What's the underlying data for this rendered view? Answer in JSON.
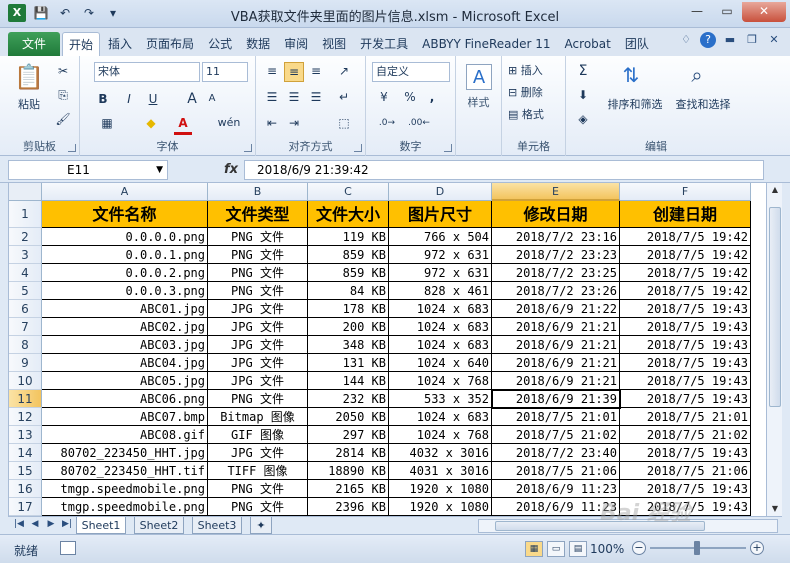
{
  "titlebar": {
    "title": "VBA获取文件夹里面的图片信息.xlsm - Microsoft Excel",
    "app_icon": "X"
  },
  "qat": {
    "icons": [
      "save-icon",
      "undo-icon",
      "redo-icon",
      "customize-icon"
    ]
  },
  "tabs": [
    "文件",
    "开始",
    "插入",
    "页面布局",
    "公式",
    "数据",
    "审阅",
    "视图",
    "开发工具",
    "ABBYY FineReader 11",
    "Acrobat",
    "团队"
  ],
  "ribbon": {
    "clipboard": {
      "label": "剪贴板",
      "paste": "粘贴"
    },
    "font": {
      "label": "字体",
      "name": "宋体",
      "size": "11",
      "bold": "B",
      "italic": "I",
      "underline": "U",
      "grow": "A",
      "shrink": "A",
      "wen": "wén"
    },
    "align": {
      "label": "对齐方式"
    },
    "number": {
      "label": "数字",
      "format": "自定义",
      "percent": "%",
      "comma": ","
    },
    "style": {
      "label": "样式"
    },
    "cells": {
      "label": "单元格",
      "insert": "插入",
      "delete": "删除",
      "format": "格式"
    },
    "editing": {
      "label": "编辑",
      "sort": "排序和筛选",
      "find": "查找和选择"
    }
  },
  "formula_bar": {
    "name_box": "E11",
    "fx": "fx",
    "formula": "2018/6/9  21:39:42"
  },
  "grid": {
    "columns": [
      "A",
      "B",
      "C",
      "D",
      "E",
      "F"
    ],
    "selected_column": "E",
    "selected_row": "11",
    "header_row": [
      "文件名称",
      "文件类型",
      "文件大小",
      "图片尺寸",
      "修改日期",
      "创建日期"
    ],
    "rows": [
      {
        "num": "1"
      },
      {
        "num": "2",
        "cells": [
          "0.0.0.0.png",
          "PNG 文件",
          "119 KB",
          "766 x 504",
          "2018/7/2 23:16",
          "2018/7/5 19:42"
        ]
      },
      {
        "num": "3",
        "cells": [
          "0.0.0.1.png",
          "PNG 文件",
          "859 KB",
          "972 x 631",
          "2018/7/2 23:23",
          "2018/7/5 19:42"
        ]
      },
      {
        "num": "4",
        "cells": [
          "0.0.0.2.png",
          "PNG 文件",
          "859 KB",
          "972 x 631",
          "2018/7/2 23:25",
          "2018/7/5 19:42"
        ]
      },
      {
        "num": "5",
        "cells": [
          "0.0.0.3.png",
          "PNG 文件",
          "84 KB",
          "828 x 461",
          "2018/7/2 23:26",
          "2018/7/5 19:42"
        ]
      },
      {
        "num": "6",
        "cells": [
          "ABC01.jpg",
          "JPG 文件",
          "178 KB",
          "1024 x 683",
          "2018/6/9 21:22",
          "2018/7/5 19:43"
        ]
      },
      {
        "num": "7",
        "cells": [
          "ABC02.jpg",
          "JPG 文件",
          "200 KB",
          "1024 x 683",
          "2018/6/9 21:21",
          "2018/7/5 19:43"
        ]
      },
      {
        "num": "8",
        "cells": [
          "ABC03.jpg",
          "JPG 文件",
          "348 KB",
          "1024 x 683",
          "2018/6/9 21:21",
          "2018/7/5 19:43"
        ]
      },
      {
        "num": "9",
        "cells": [
          "ABC04.jpg",
          "JPG 文件",
          "131 KB",
          "1024 x 640",
          "2018/6/9 21:21",
          "2018/7/5 19:43"
        ]
      },
      {
        "num": "10",
        "cells": [
          "ABC05.jpg",
          "JPG 文件",
          "144 KB",
          "1024 x 768",
          "2018/6/9 21:21",
          "2018/7/5 19:43"
        ]
      },
      {
        "num": "11",
        "cells": [
          "ABC06.png",
          "PNG 文件",
          "232 KB",
          "533 x 352",
          "2018/6/9 21:39",
          "2018/7/5 19:43"
        ]
      },
      {
        "num": "12",
        "cells": [
          "ABC07.bmp",
          "Bitmap 图像",
          "2050 KB",
          "1024 x 683",
          "2018/7/5 21:01",
          "2018/7/5 21:01"
        ]
      },
      {
        "num": "13",
        "cells": [
          "ABC08.gif",
          "GIF 图像",
          "297 KB",
          "1024 x 768",
          "2018/7/5 21:02",
          "2018/7/5 21:02"
        ]
      },
      {
        "num": "14",
        "cells": [
          "80702_223450_HHT.jpg",
          "JPG 文件",
          "2814 KB",
          "4032 x 3016",
          "2018/7/2 23:40",
          "2018/7/5 19:43"
        ]
      },
      {
        "num": "15",
        "cells": [
          "80702_223450_HHT.tif",
          "TIFF 图像",
          "18890 KB",
          "4031 x 3016",
          "2018/7/5 21:06",
          "2018/7/5 21:06"
        ]
      },
      {
        "num": "16",
        "cells": [
          "tmgp.speedmobile.png",
          "PNG 文件",
          "2165 KB",
          "1920 x 1080",
          "2018/6/9 11:23",
          "2018/7/5 19:43"
        ]
      },
      {
        "num": "17",
        "cells": [
          "tmgp.speedmobile.png",
          "PNG 文件",
          "2396 KB",
          "1920 x 1080",
          "2018/6/9 11:23",
          "2018/7/5 19:43"
        ]
      }
    ]
  },
  "sheets": [
    "Sheet1",
    "Sheet2",
    "Sheet3"
  ],
  "status": {
    "ready": "就绪",
    "zoom": "100%",
    "minus": "−",
    "plus": "+"
  },
  "watermark": "Bai 经验"
}
